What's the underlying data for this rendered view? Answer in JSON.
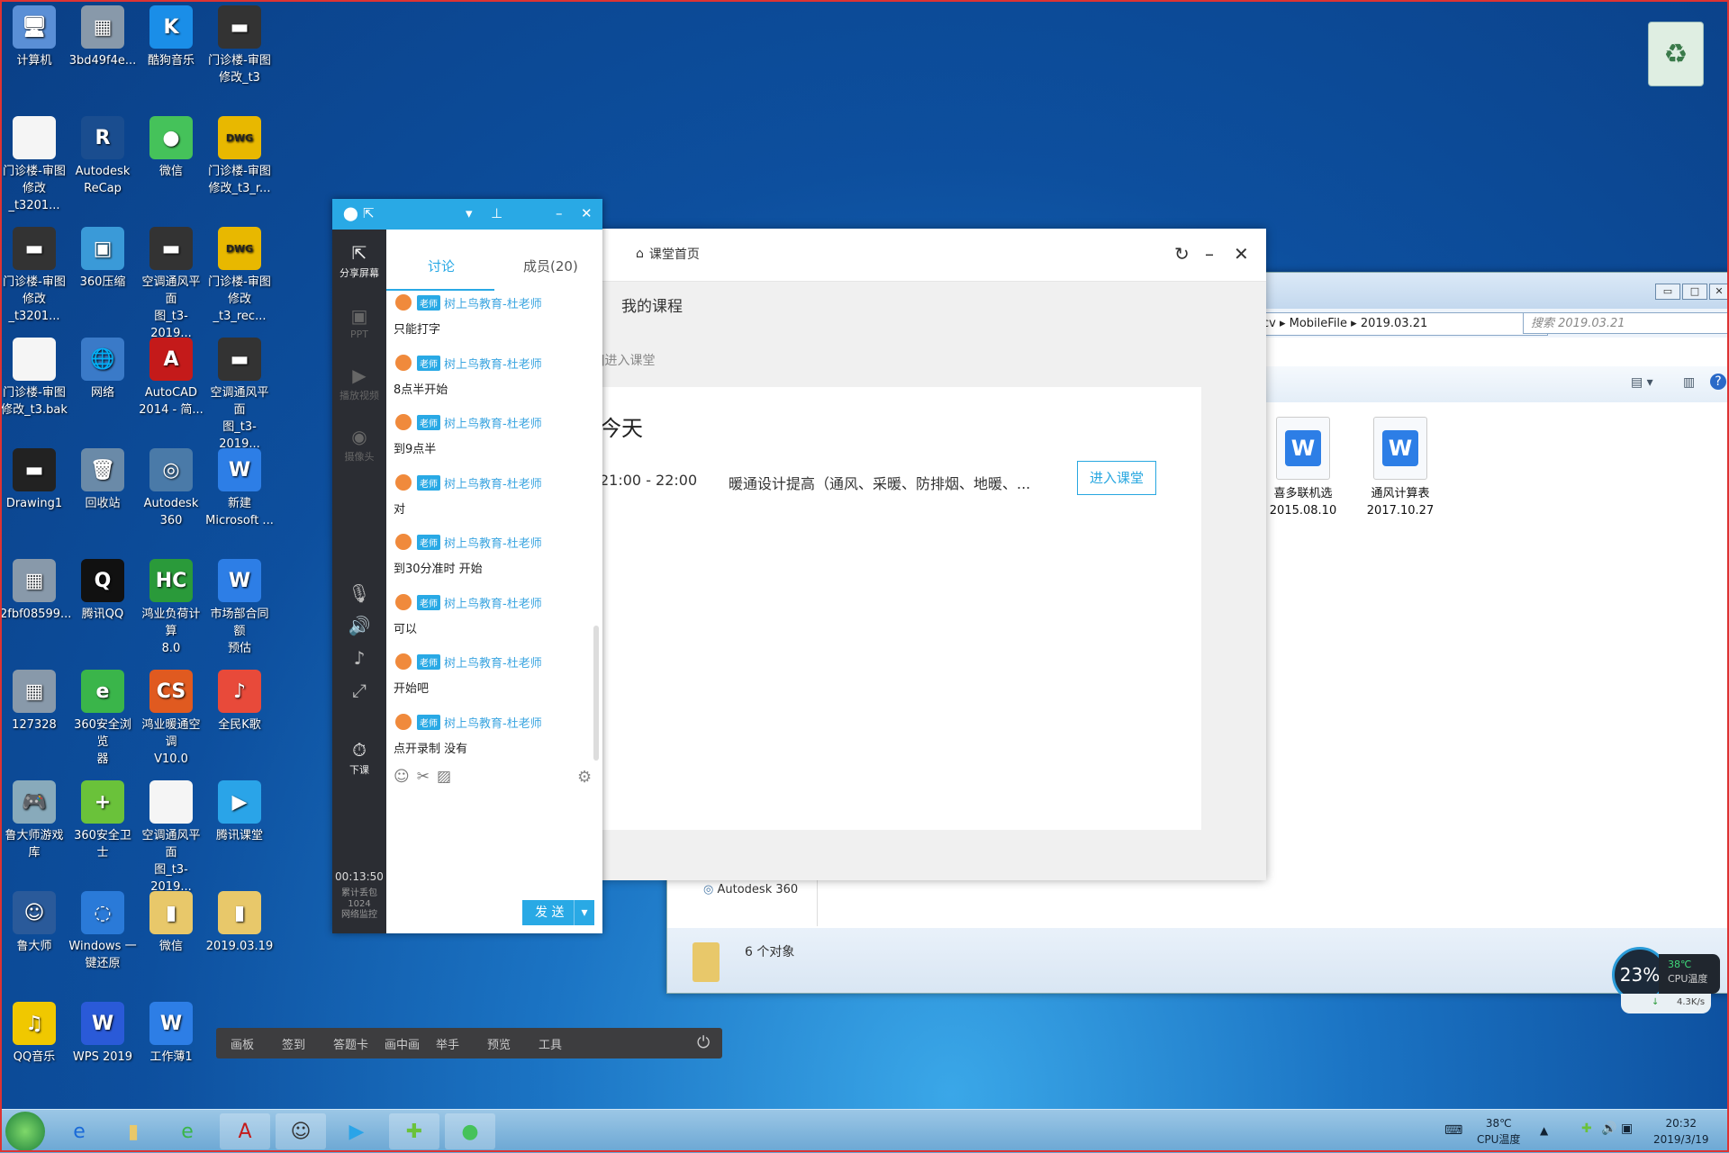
{
  "desktop": {
    "icons": [
      {
        "label": "计算机",
        "glyph": "🖥",
        "color": "#5a8fd6"
      },
      {
        "label": "3bd49f4e...",
        "glyph": "▦",
        "color": "#8899aa"
      },
      {
        "label": "酷狗音乐",
        "glyph": "K",
        "color": "#1a8ee8"
      },
      {
        "label": "门诊楼-审图\n修改_t3",
        "glyph": "▬",
        "color": "#333"
      },
      {
        "label": "门诊楼-审图\n修改_t3201...",
        "glyph": "",
        "color": "#f5f5f5"
      },
      {
        "label": "Autodesk\nReCap",
        "glyph": "R",
        "color": "#1a4d8f"
      },
      {
        "label": "微信",
        "glyph": "●",
        "color": "#45c25a"
      },
      {
        "label": "门诊楼-审图\n修改_t3_r...",
        "glyph": "DWG",
        "color": "#e8b800"
      },
      {
        "label": "门诊楼-审图\n修改_t3201...",
        "glyph": "▬",
        "color": "#333"
      },
      {
        "label": "360压缩",
        "glyph": "▣",
        "color": "#3a9ad8"
      },
      {
        "label": "空调通风平面\n图_t3-2019...",
        "glyph": "▬",
        "color": "#333"
      },
      {
        "label": "门诊楼-审图\n修改_t3_rec...",
        "glyph": "DWG",
        "color": "#e8b800"
      },
      {
        "label": "门诊楼-审图\n修改_t3.bak",
        "glyph": "",
        "color": "#f5f5f5"
      },
      {
        "label": "网络",
        "glyph": "🌐",
        "color": "#3a7ac8"
      },
      {
        "label": "AutoCAD\n2014 - 简...",
        "glyph": "A",
        "color": "#c41a1a"
      },
      {
        "label": "空调通风平面\n图_t3-2019...",
        "glyph": "▬",
        "color": "#333"
      },
      {
        "label": "Drawing1",
        "glyph": "▬",
        "color": "#222"
      },
      {
        "label": "回收站",
        "glyph": "🗑",
        "color": "#6a8aa8"
      },
      {
        "label": "Autodesk\n360",
        "glyph": "◎",
        "color": "#4a7aa8"
      },
      {
        "label": "新建\nMicrosoft ...",
        "glyph": "W",
        "color": "#2d7ee6"
      },
      {
        "label": "2fbf08599...",
        "glyph": "▦",
        "color": "#8899aa"
      },
      {
        "label": "腾讯QQ",
        "glyph": "Q",
        "color": "#111"
      },
      {
        "label": "鸿业负荷计算\n8.0",
        "glyph": "HC",
        "color": "#2a9a3a"
      },
      {
        "label": "市场部合同额\n预估",
        "glyph": "W",
        "color": "#2d7ee6"
      },
      {
        "label": "127328",
        "glyph": "▦",
        "color": "#8899aa"
      },
      {
        "label": "360安全浏览\n器",
        "glyph": "e",
        "color": "#3ab54a"
      },
      {
        "label": "鸿业暖通空调\nV10.0",
        "glyph": "CS",
        "color": "#e05a20"
      },
      {
        "label": "全民K歌",
        "glyph": "♪",
        "color": "#e84a3a"
      },
      {
        "label": "鲁大师游戏库",
        "glyph": "🎮",
        "color": "#8ab"
      },
      {
        "label": "360安全卫士",
        "glyph": "+",
        "color": "#6ac23a"
      },
      {
        "label": "空调通风平面\n图_t3-2019...",
        "glyph": "",
        "color": "#f5f5f5"
      },
      {
        "label": "腾讯课堂",
        "glyph": "▶",
        "color": "#2aa4e8"
      },
      {
        "label": "鲁大师",
        "glyph": "☺",
        "color": "#2a5a9a"
      },
      {
        "label": "Windows 一\n键还原",
        "glyph": "◌",
        "color": "#2a7ad8"
      },
      {
        "label": "微信",
        "glyph": "▮",
        "color": "#e8c86a"
      },
      {
        "label": "2019.03.19",
        "glyph": "▮",
        "color": "#e8c86a"
      },
      {
        "label": "QQ音乐",
        "glyph": "♫",
        "color": "#f0c800"
      },
      {
        "label": "WPS 2019",
        "glyph": "W",
        "color": "#2a5ad8"
      },
      {
        "label": "工作薄1",
        "glyph": "W",
        "color": "#2d7ee6"
      }
    ]
  },
  "explorer": {
    "breadcrumb": "cv ▸ MobileFile ▸ 2019.03.21",
    "search_placeholder": "搜索 2019.03.21",
    "files": [
      {
        "name": "喜多联机选\n2015.08.10"
      },
      {
        "name": "通风计算表\n2017.10.27"
      }
    ],
    "nav_item": "Autodesk 360",
    "status": "6 个对象"
  },
  "classroom": {
    "home_label": "课堂首页",
    "my_courses": "我的课程",
    "enter_hint": "]进入课堂",
    "today": "今天",
    "time": "21:00 - 22:00",
    "course_title": "暖通设计提高（通风、采暖、防排烟、地暖、...",
    "enter_button": "进入课堂"
  },
  "chat": {
    "side": {
      "share": "分享屏幕",
      "ppt": "PPT",
      "video": "播放视频",
      "camera": "摄像头",
      "end_class": "下课",
      "timer": "00:13:50",
      "stats": "累计丢包\n1024\n网络监控"
    },
    "tabs": {
      "discuss": "讨论",
      "members": "成员(20)"
    },
    "badge": "老师",
    "sender": "树上鸟教育-杜老师",
    "messages": [
      "只能打字",
      "8点半开始",
      "到9点半",
      "对",
      "到30分准时 开始",
      "可以",
      "开始吧",
      "点开录制 没有"
    ],
    "send": "发 送"
  },
  "toolstrip": [
    "画板",
    "签到",
    "答题卡",
    "画中画",
    "举手",
    "预览",
    "工具"
  ],
  "widget": {
    "cpu_percent": "23%",
    "cpu_temp": "38℃",
    "cpu_label": "CPU温度",
    "net_speed": "4.3K/s"
  },
  "taskbar": {
    "tray_temp": "38℃",
    "tray_label": "CPU温度",
    "clock_time": "20:32",
    "clock_date": "2019/3/19"
  }
}
